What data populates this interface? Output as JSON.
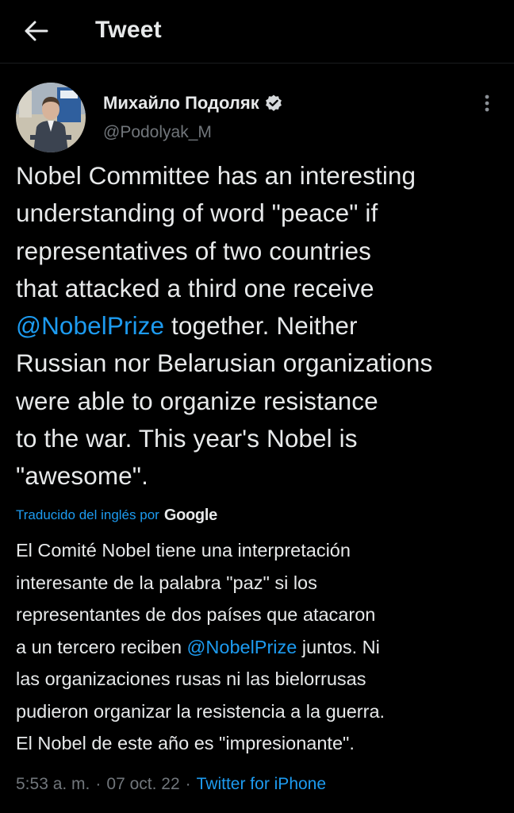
{
  "header": {
    "title": "Tweet",
    "back_icon": "arrow-left-icon"
  },
  "author": {
    "name": "Михайло Подоляк",
    "handle": "@Podolyak_M",
    "verified": true,
    "verified_icon": "verified-badge-icon",
    "more_icon": "more-vertical-icon"
  },
  "tweet": {
    "text_before": "Nobel Committee has an interesting\nunderstanding of word \"peace\" if\nrepresentatives of two countries\nthat attacked a third one receive\n",
    "mention": "@NobelPrize",
    "text_after": " together. Neither\nRussian nor Belarusian organizations\nwere able to organize resistance\nto the war. This year's Nobel is\n\"awesome\"."
  },
  "translation": {
    "label": "Traducido del inglés por",
    "provider": "Google",
    "text_before": "El Comité Nobel tiene una interpretación\ninteresante de la palabra \"paz\" si los\nrepresentantes de dos países que atacaron\na un tercero reciben ",
    "mention": "@NobelPrize",
    "text_after": " juntos. Ni\nlas organizaciones rusas ni las bielorrusas\npudieron organizar la resistencia a la guerra.\nEl Nobel de este año es \"impresionante\"."
  },
  "meta": {
    "time": "5:53 a. m.",
    "separator": "·",
    "date": "07 oct. 22",
    "source": "Twitter for iPhone"
  },
  "colors": {
    "background": "#000000",
    "text": "#e7e9ea",
    "secondary": "#71767b",
    "accent": "#1d9bf0"
  }
}
